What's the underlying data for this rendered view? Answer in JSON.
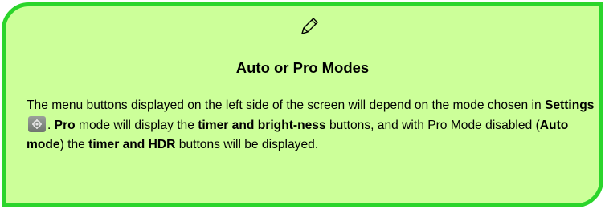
{
  "note": {
    "title": "Auto or Pro Modes",
    "icon": "pencil-icon",
    "colors": {
      "background": "#ccff99",
      "border": "#2bd52b"
    },
    "body": {
      "t1": "The menu buttons displayed on the left side of the screen will depend on the mode chosen in ",
      "settings": "Settings",
      "settings_icon": "gear-icon",
      "t2": ". ",
      "pro": "Pro",
      "t3": " mode will display the ",
      "timer_brightness": "timer and bright-ness",
      "t4": " buttons, and with Pro Mode disabled (",
      "auto_mode": "Auto mode",
      "t5": ") the ",
      "timer_hdr": "timer and HDR",
      "t6": " buttons will be displayed."
    }
  }
}
